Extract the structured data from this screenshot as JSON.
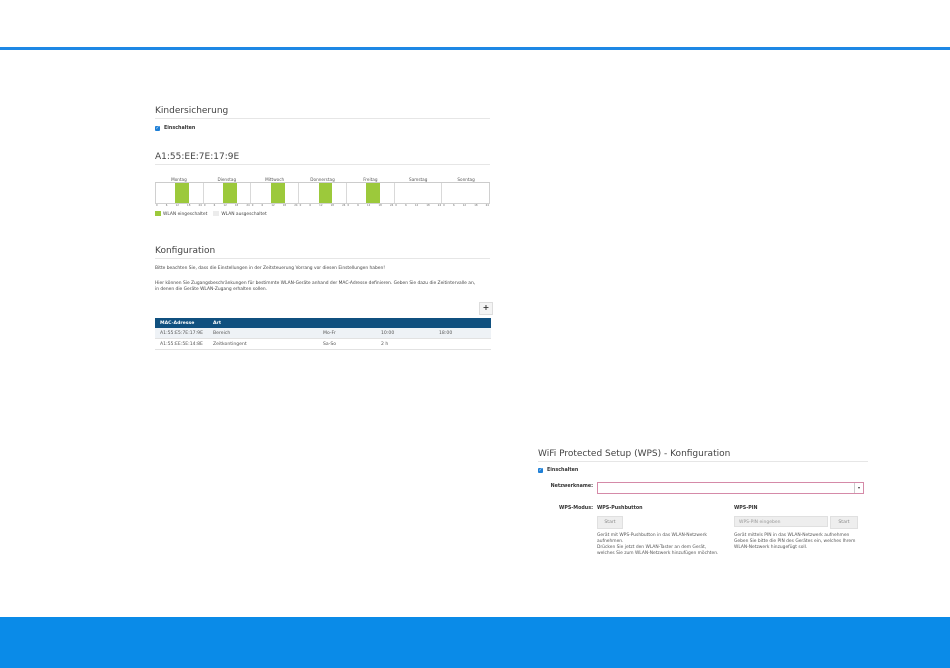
{
  "colors": {
    "accent": "#1e88e5",
    "green": "#9cc93b",
    "table_header": "#10507f",
    "footer": "#0a8be8"
  },
  "kindersicherung": {
    "title": "Kindersicherung",
    "enable_label": "Einschalten"
  },
  "device": {
    "mac_title": "A1:55:EE:7E:17:9E"
  },
  "schedule": {
    "days": [
      "Montag",
      "Dienstag",
      "Mittwoch",
      "Donnerstag",
      "Freitag",
      "Samstag",
      "Sonntag"
    ],
    "tick_labels": [
      "0",
      "6",
      "12",
      "18",
      "24"
    ],
    "on_intervals": [
      [
        10,
        17
      ],
      [
        10,
        17
      ],
      [
        10,
        17
      ],
      [
        10,
        17
      ],
      [
        10,
        17
      ],
      null,
      null
    ],
    "legend": {
      "on": "WLAN eingeschaltet",
      "off": "WLAN ausgeschaltet"
    }
  },
  "konfiguration": {
    "title": "Konfiguration",
    "note1": "Bitte beachten Sie, dass die Einstellungen in der Zeitsteuerung Vorrang vor diesen Einstellungen haben!",
    "note2": "Hier können Sie Zugangsbeschränkungen für bestimmte WLAN-Geräte anhand der MAC-Adresse definieren. Geben Sie dazu die Zeitintervalle an,",
    "note3": "in denen die Geräte WLAN-Zugang erhalten sollen.",
    "add_label": "+",
    "table": {
      "headers": [
        "MAC-Adresse",
        "Art",
        "",
        "",
        ""
      ],
      "rows": [
        [
          "A1:55:E5:7E:17:9E",
          "Bereich",
          "Mo-Fr",
          "10:00",
          "18:00"
        ],
        [
          "A1:55:EE:5E:14:8E",
          "Zeitkontingent",
          "Sa-So",
          "2 h",
          ""
        ]
      ]
    }
  },
  "wps": {
    "title": "WiFi Protected Setup (WPS) - Konfiguration",
    "enable_label": "Einschalten",
    "network_label": "Netzwerkname:",
    "network_value": "",
    "mode_label": "WPS-Modus:",
    "pushbutton": {
      "title": "WPS-Pushbutton",
      "start": "Start",
      "desc1": "Gerät mit WPS-Pushbutton in das WLAN-Netzwerk",
      "desc2": "aufnehmen.",
      "desc3": "Drücken Sie jetzt den WLAN-Taster an dem Gerät,",
      "desc4": "welches Sie zum WLAN-Netzwerk hinzufügen möchten."
    },
    "pin": {
      "title": "WPS-PIN",
      "placeholder": "WPS-PIN eingeben",
      "start": "Start",
      "desc1": "Gerät mittels PIN in das WLAN-Netzwerk aufnehmen",
      "desc2": "Geben Sie bitte die PIN des Gerätes ein, welches Ihrem",
      "desc3": "WLAN-Netzwerk hinzugefügt soll."
    }
  }
}
